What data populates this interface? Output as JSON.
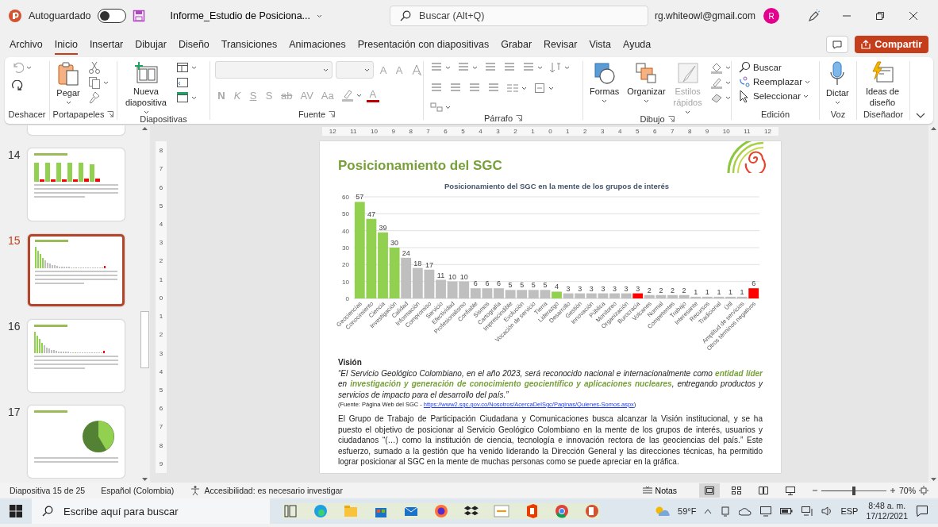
{
  "title_bar": {
    "autosave_label": "Autoguardado",
    "autosave_on": false,
    "file_name": "Informe_Estudio de Posiciona...",
    "search_placeholder": "Buscar (Alt+Q)",
    "account": "rg.whiteowl@gmail.com",
    "avatar_initial": "R"
  },
  "menu_tabs": [
    {
      "label": "Archivo",
      "selected": false
    },
    {
      "label": "Inicio",
      "selected": true
    },
    {
      "label": "Insertar",
      "selected": false
    },
    {
      "label": "Dibujar",
      "selected": false
    },
    {
      "label": "Diseño",
      "selected": false
    },
    {
      "label": "Transiciones",
      "selected": false
    },
    {
      "label": "Animaciones",
      "selected": false
    },
    {
      "label": "Presentación con diapositivas",
      "selected": false
    },
    {
      "label": "Grabar",
      "selected": false
    },
    {
      "label": "Revisar",
      "selected": false
    },
    {
      "label": "Vista",
      "selected": false
    },
    {
      "label": "Ayuda",
      "selected": false
    }
  ],
  "share_button": "Compartir",
  "ribbon": {
    "groups": [
      {
        "label": "Deshacer",
        "undo_disabled": true
      },
      {
        "label": "Portapapeles",
        "paste": "Pegar"
      },
      {
        "label": "Diapositivas",
        "new_slide": "Nueva diapositiva"
      },
      {
        "label": "Fuente",
        "disabled": true,
        "grow": "A",
        "shrink": "A",
        "format_buttons": [
          "N",
          "K",
          "S",
          "S",
          "ab",
          "AV",
          "Aa"
        ],
        "font_color": "A"
      },
      {
        "label": "Párrafo"
      },
      {
        "label": "Dibujo",
        "shapes": "Formas",
        "arrange": "Organizar",
        "quick_styles": {
          "label": "Estilos rápidos",
          "disabled": true
        }
      },
      {
        "label": "Edición",
        "find": "Buscar",
        "replace": "Reemplazar",
        "select": "Seleccionar"
      },
      {
        "label": "Voz",
        "dictate": "Dictar"
      },
      {
        "label": "Diseñador",
        "design_ideas": "Ideas de diseño"
      }
    ]
  },
  "thumbnails": [
    {
      "number": "14",
      "kind": "bars",
      "selected": false
    },
    {
      "number": "15",
      "kind": "chart",
      "selected": true
    },
    {
      "number": "16",
      "kind": "chart",
      "selected": false
    },
    {
      "number": "17",
      "kind": "pie",
      "selected": false
    }
  ],
  "ruler_horizontal": [
    "12",
    "11",
    "10",
    "9",
    "8",
    "7",
    "6",
    "5",
    "4",
    "3",
    "2",
    "1",
    "0",
    "1",
    "2",
    "3",
    "4",
    "5",
    "6",
    "7",
    "8",
    "9",
    "10",
    "11",
    "12"
  ],
  "ruler_vertical": [
    "8",
    "7",
    "6",
    "5",
    "4",
    "3",
    "2",
    "1",
    "0",
    "1",
    "2",
    "3",
    "4",
    "5",
    "6",
    "7",
    "8",
    "9"
  ],
  "slide": {
    "title": "Posicionamiento del SGC",
    "chart_data": {
      "type": "bar",
      "title": "Posicionamiento del SGC en la mente de los grupos de interés",
      "stacked": true,
      "grid": true,
      "data_labels": true,
      "yticks": [
        0,
        10,
        20,
        30,
        40,
        50,
        60
      ],
      "ylim": [
        0,
        60
      ],
      "categories": [
        "Geociencias",
        "Conocimiento",
        "Ciencia",
        "Investigación",
        "Calidad",
        "Información",
        "Compromiso",
        "Servicio",
        "Efectividad",
        "Profesionalismo",
        "Confiable",
        "Sismos",
        "Cartografía",
        "Imprescindible",
        "Evolución",
        "Vocación de servicio",
        "Tierra",
        "Liderazgo",
        "Desarrollo",
        "Gestión",
        "Innovación",
        "Pública",
        "Monitoreo",
        "Organización",
        "Burocracia",
        "Volcanes",
        "Normal",
        "Competentes",
        "Trabajo",
        "Interesante",
        "Recursos",
        "Tradicional",
        "Útil",
        "Amplitud de servicios",
        "Otros términos negativos"
      ],
      "series": [
        {
          "color": "#92d050",
          "values": [
            57,
            47,
            39,
            30,
            null,
            null,
            null,
            null,
            null,
            null,
            null,
            null,
            null,
            null,
            null,
            null,
            null,
            4,
            null,
            null,
            null,
            null,
            null,
            null,
            null,
            null,
            null,
            null,
            null,
            null,
            null,
            null,
            null,
            null,
            null
          ]
        },
        {
          "color": "#bfbfbf",
          "values": [
            null,
            null,
            null,
            null,
            24,
            18,
            17,
            11,
            10,
            10,
            6,
            6,
            6,
            5,
            5,
            5,
            5,
            null,
            3,
            3,
            3,
            3,
            3,
            3,
            null,
            2,
            2,
            2,
            2,
            1,
            1,
            1,
            1,
            1,
            null
          ]
        },
        {
          "color": "#ff0000",
          "values": [
            null,
            null,
            null,
            null,
            null,
            null,
            null,
            null,
            null,
            null,
            null,
            null,
            null,
            null,
            null,
            null,
            null,
            null,
            null,
            null,
            null,
            null,
            null,
            null,
            3,
            null,
            null,
            null,
            null,
            null,
            null,
            null,
            null,
            null,
            6
          ]
        }
      ]
    },
    "vision_heading": "Visión",
    "vision_quote": "“El Servicio Geológico Colombiano, en el año 2023, será reconocido nacional e internacionalmente como **entidad líder** en **investigación y generación de conocimiento geocientífico y aplicaciones nucleares**, entregando productos y servicios de impacto para el desarrollo del país.”",
    "source": {
      "prefix": "(Fuente: Página Web del SGC - ",
      "link": "https://www2.sgc.gov.co/Nosotros/AcercaDelSgc/Paginas/Quienes-Somos.aspx",
      "suffix": ")"
    },
    "body": "El Grupo de Trabajo de Participación Ciudadana y Comunicaciones busca alcanzar la Visión institucional, y se ha puesto el objetivo de posicionar al Servicio Geológico Colombiano en la mente de los grupos de interés, usuarios y ciudadanos “(…) como la institución de ciencia, tecnología e innovación rectora de las geociencias del país.” Este esfuerzo, sumado a la gestión que ha venido liderando la Dirección General y las direcciones técnicas, ha permitido lograr posicionar al SGC en la mente de muchas personas como se puede apreciar en la gráfica."
  },
  "status_bar": {
    "slide_info": "Diapositiva 15 de 25",
    "language": "Español (Colombia)",
    "accessibility": "Accesibilidad: es necesario investigar",
    "notes": "Notas",
    "views": [
      {
        "selected": true
      },
      {
        "selected": false
      },
      {
        "selected": false
      },
      {
        "selected": false
      }
    ],
    "zoom": {
      "level": 0.5,
      "reading": "70%"
    }
  },
  "taskbar": {
    "search_placeholder": "Escribe aquí para buscar",
    "weather": "59°F",
    "language": "ESP",
    "time": "8:48 a. m.",
    "date": "17/12/2021"
  }
}
